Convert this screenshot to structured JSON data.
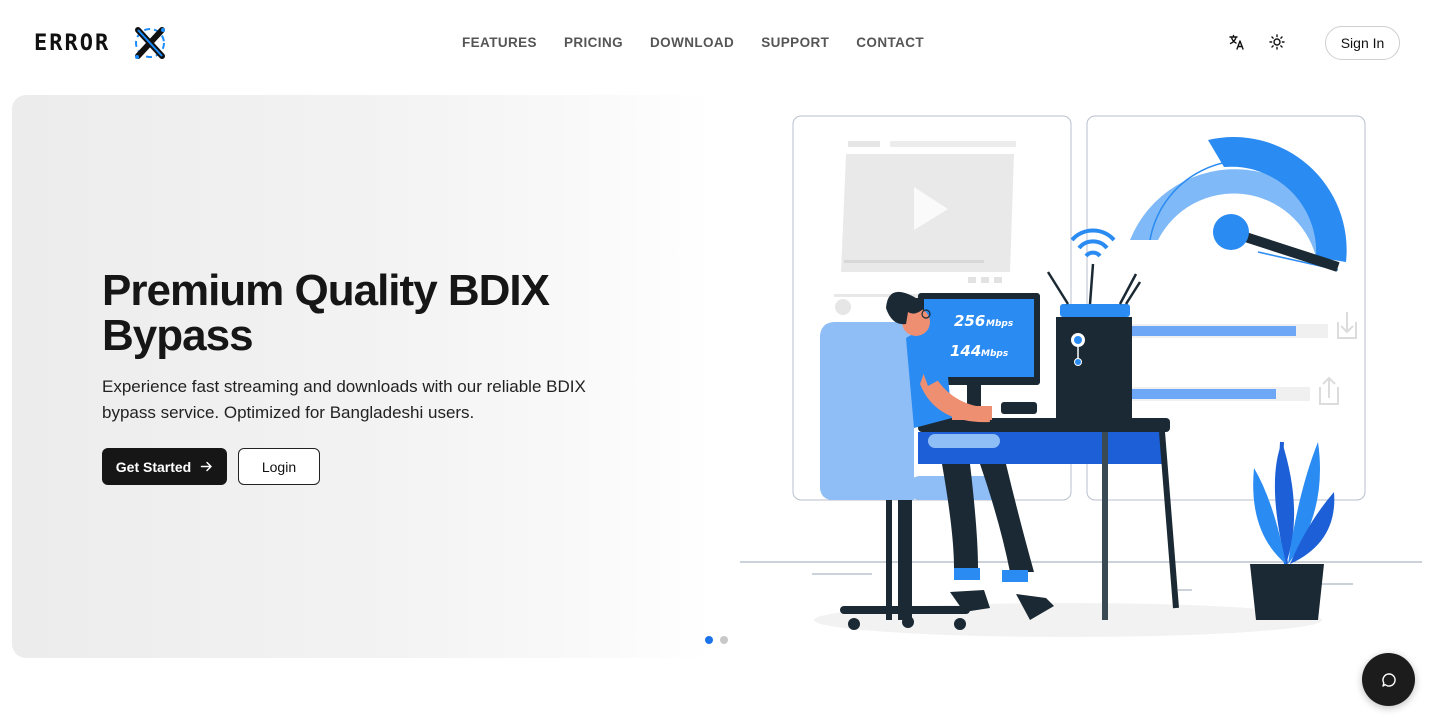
{
  "header": {
    "logo_text": "ERROR",
    "nav": [
      "FEATURES",
      "PRICING",
      "DOWNLOAD",
      "SUPPORT",
      "CONTACT"
    ],
    "translate_icon": "translate-icon",
    "theme_icon": "sun-icon",
    "signin_label": "Sign In"
  },
  "hero": {
    "title": "Premium Quality BDIX Bypass",
    "subtitle": "Experience fast streaming and downloads with our reliable BDIX bypass service. Optimized for Bangladeshi users.",
    "primary_button": "Get Started",
    "secondary_button": "Login",
    "carousel": {
      "slides": 2,
      "active": 0
    }
  },
  "illustration": {
    "download_speed": "256",
    "upload_speed": "144",
    "speed_unit": "Mbps"
  },
  "colors": {
    "accent": "#1a73e8",
    "illustration_blue": "#2a8bf2",
    "dark": "#161616"
  },
  "chat": {
    "icon": "chat-icon"
  }
}
